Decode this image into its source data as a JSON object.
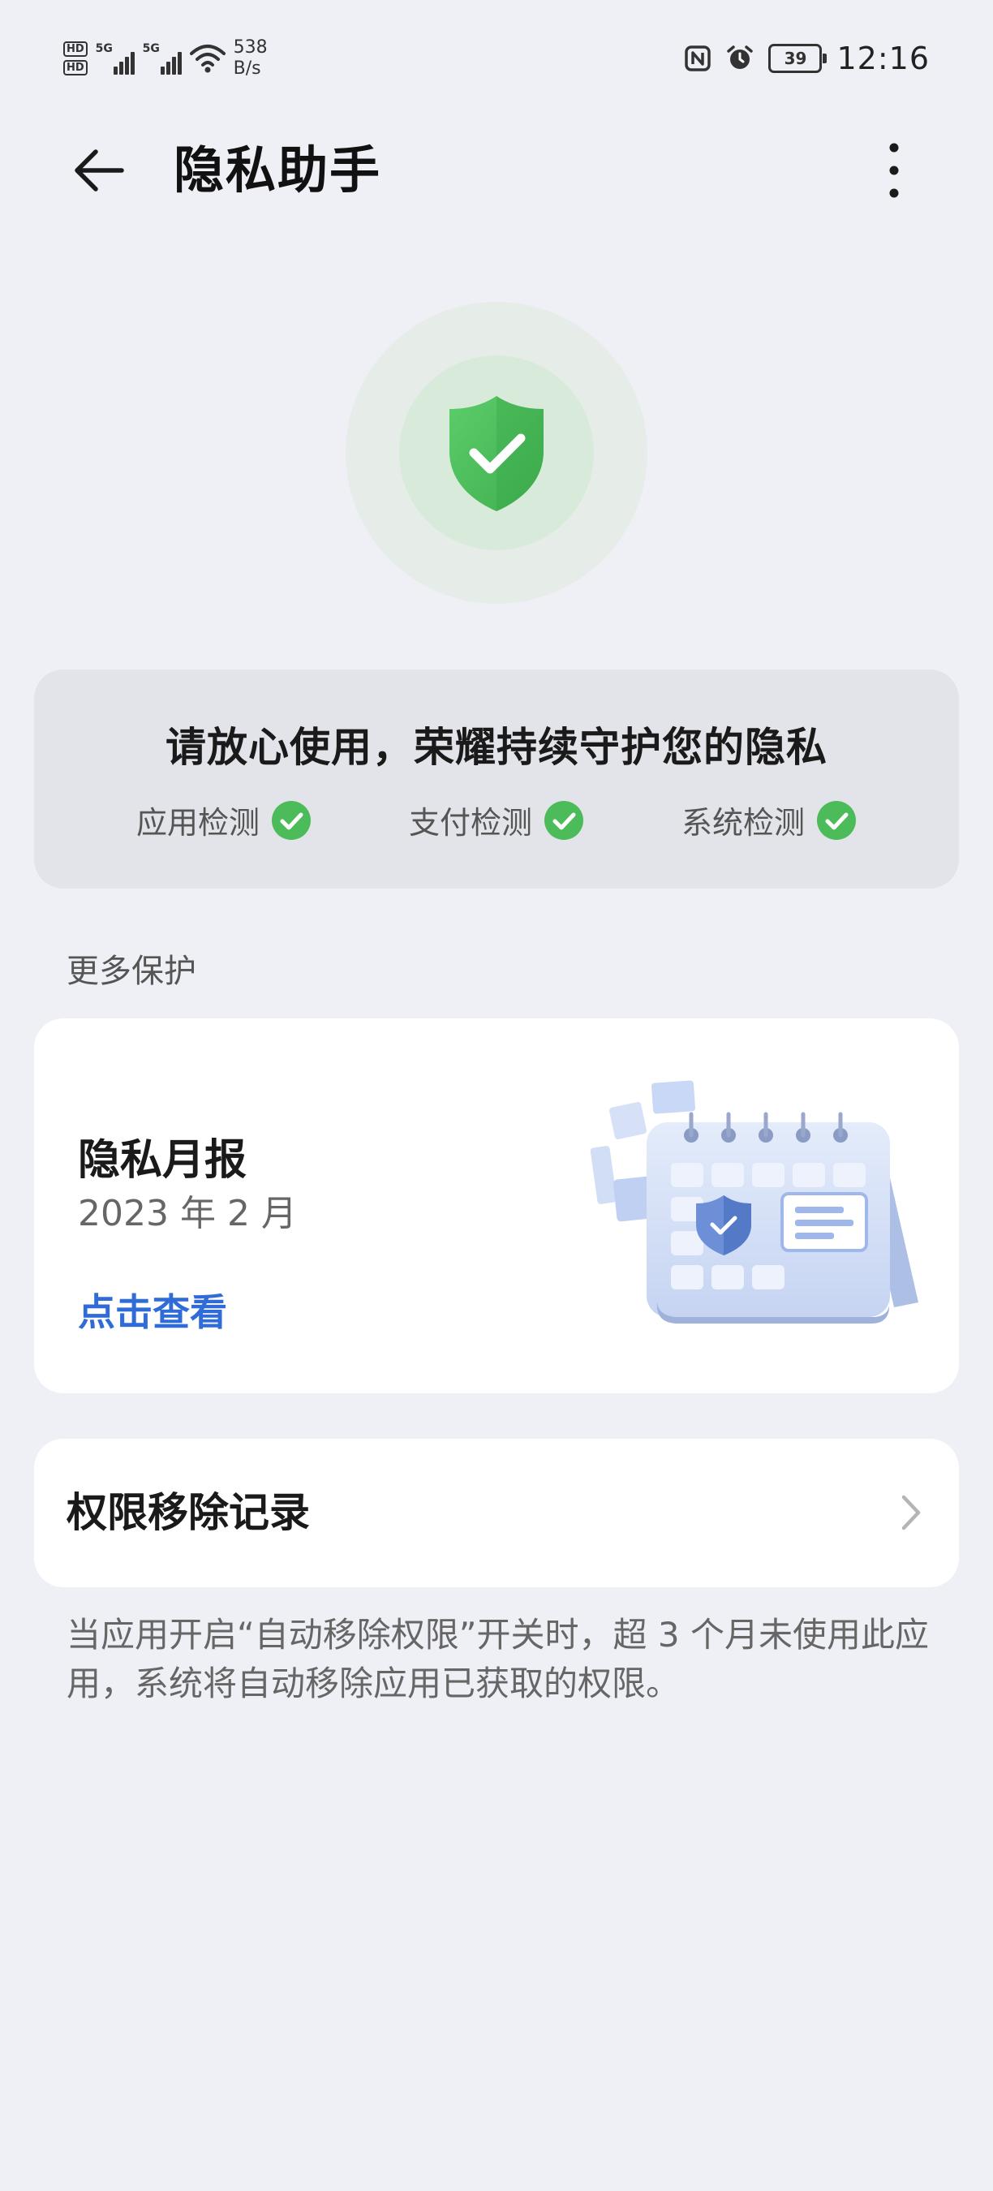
{
  "status_bar": {
    "hd_badges": [
      "HD",
      "HD"
    ],
    "signal_labels": [
      "5G",
      "5G"
    ],
    "net_speed": [
      "538",
      "B/s"
    ],
    "battery": "39",
    "time": "12:16",
    "icons": [
      "nfc-icon",
      "alarm-icon",
      "wifi-icon",
      "battery-icon"
    ]
  },
  "header": {
    "title": "隐私助手",
    "back_icon": "back-arrow-icon",
    "more_icon": "more-vertical-icon"
  },
  "hero": {
    "icon": "shield-check-icon",
    "colors": {
      "outer": "#e6ece8",
      "inner": "#d8ebdb",
      "shield": "#4cbb5a"
    }
  },
  "status_card": {
    "headline": "请放心使用，荣耀持续守护您的隐私",
    "checks": [
      {
        "label": "应用检测",
        "icon": "check-circle-icon"
      },
      {
        "label": "支付检测",
        "icon": "check-circle-icon"
      },
      {
        "label": "系统检测",
        "icon": "check-circle-icon"
      }
    ],
    "check_color": "#4cbb5a"
  },
  "more_protection": {
    "section_title": "更多保护",
    "report": {
      "title": "隐私月报",
      "date": "2023 年 2 月",
      "link": "点击查看",
      "illustration": "calendar-shield-illustration"
    },
    "permission_record": {
      "label": "权限移除记录",
      "chevron_icon": "chevron-right-icon"
    },
    "note": "当应用开启“自动移除权限”开关时，超 3 个月未使用此应用，系统将自动移除应用已获取的权限。"
  },
  "colors": {
    "background": "#eff0f5",
    "card": "#ffffff",
    "accent_link": "#2f6cd8"
  }
}
